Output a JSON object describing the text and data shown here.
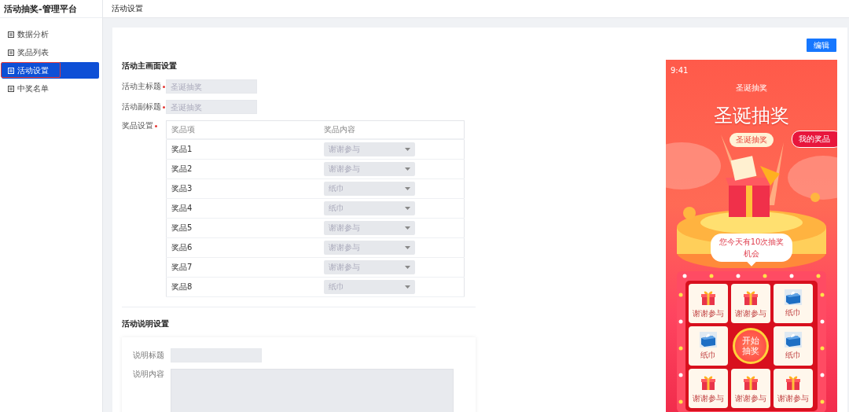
{
  "app": {
    "title": "活动抽奖-管理平台"
  },
  "sidebar": {
    "items": [
      {
        "label": "数据分析",
        "selected": false
      },
      {
        "label": "奖品列表",
        "selected": false
      },
      {
        "label": "活动设置",
        "selected": true
      },
      {
        "label": "中奖名单",
        "selected": false
      }
    ]
  },
  "header": {
    "title": "活动设置"
  },
  "toolbar": {
    "edit_button": "编辑"
  },
  "main_section": {
    "title": "活动主画面设置",
    "fields": [
      {
        "label": "活动主标题",
        "required": true,
        "placeholder": "圣诞抽奖"
      },
      {
        "label": "活动副标题",
        "required": true,
        "placeholder": "圣诞抽奖"
      }
    ],
    "prize_settings": {
      "label": "奖品设置",
      "required": true,
      "columns": [
        "奖品项",
        "奖品内容"
      ],
      "rows": [
        {
          "name": "奖品1",
          "value": "谢谢参与"
        },
        {
          "name": "奖品2",
          "value": "谢谢参与"
        },
        {
          "name": "奖品3",
          "value": "纸巾"
        },
        {
          "name": "奖品4",
          "value": "纸巾"
        },
        {
          "name": "奖品5",
          "value": "谢谢参与"
        },
        {
          "name": "奖品6",
          "value": "谢谢参与"
        },
        {
          "name": "奖品7",
          "value": "谢谢参与"
        },
        {
          "name": "奖品8",
          "value": "纸巾"
        }
      ]
    }
  },
  "description_section": {
    "title": "活动说明设置",
    "fields": [
      {
        "label": "说明标题",
        "kind": "input"
      },
      {
        "label": "说明内容",
        "kind": "textarea"
      }
    ]
  },
  "preview": {
    "time": "9:41",
    "nav_title": "圣诞抽奖",
    "headline": "圣诞抽奖",
    "badge": "圣诞抽奖",
    "my_prizes_button": "我的奖品",
    "chances_bubble": "您今天有10次抽奖机会",
    "start_button": "开始抽奖",
    "grid": [
      {
        "label": "谢谢参与",
        "kind": "gift"
      },
      {
        "label": "谢谢参与",
        "kind": "gift"
      },
      {
        "label": "纸巾",
        "kind": "tissue"
      },
      {
        "label": "纸巾",
        "kind": "tissue"
      },
      {
        "label": "纸巾",
        "kind": "tissue"
      },
      {
        "label": "谢谢参与",
        "kind": "gift"
      },
      {
        "label": "谢谢参与",
        "kind": "gift"
      },
      {
        "label": "谢谢参与",
        "kind": "gift"
      }
    ]
  }
}
